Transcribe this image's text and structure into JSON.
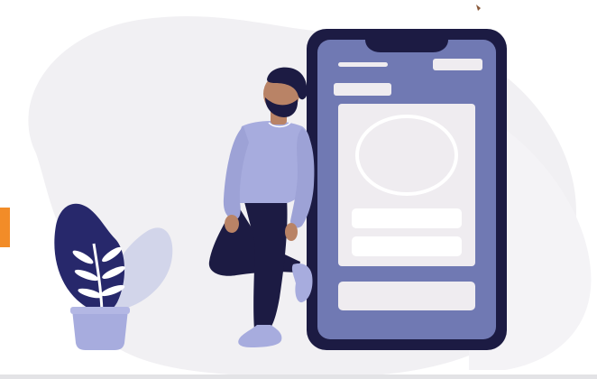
{
  "illustration": {
    "subject": "person-leaning-on-phone",
    "colors": {
      "background_blob": "#f1f0f3",
      "phone_frame": "#1c1b43",
      "phone_screen": "#7079b3",
      "phone_card": "#efecf0",
      "phone_pill": "#ffffff",
      "sweater": "#a7acde",
      "pants": "#1c1b43",
      "skin": "#b98366",
      "hair": "#1c1b43",
      "shoes": "#a7acde",
      "plant_leaf_dark": "#27286b",
      "plant_leaf_light": "#ccd0e8",
      "pot": "#a7acde",
      "orange_tab": "#f28c28",
      "brown_dot": "#8a5a3b"
    }
  }
}
